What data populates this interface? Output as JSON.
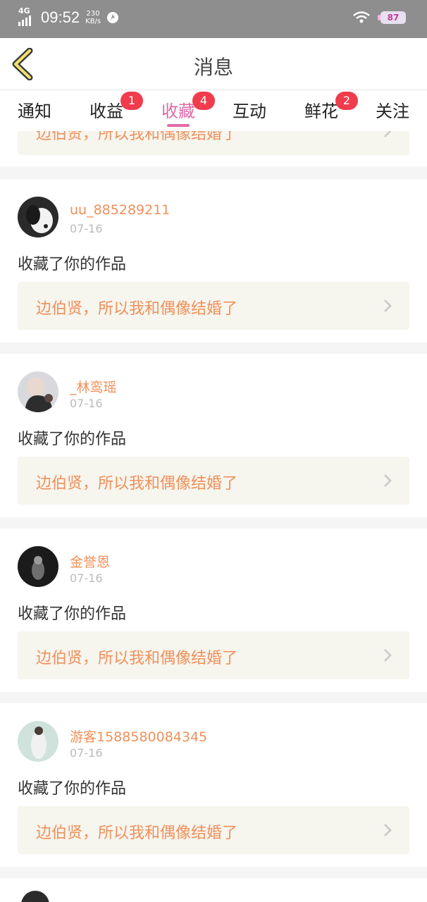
{
  "status_bar": {
    "network": "4G",
    "time": "09:52",
    "speed_value": "230",
    "speed_unit": "KB/s",
    "battery": "87"
  },
  "header": {
    "title": "消息"
  },
  "tabs": [
    {
      "label": "通知",
      "badge": ""
    },
    {
      "label": "收益",
      "badge": "1"
    },
    {
      "label": "收藏",
      "badge": "4",
      "active": true
    },
    {
      "label": "互动",
      "badge": ""
    },
    {
      "label": "鲜花",
      "badge": "2"
    },
    {
      "label": "关注",
      "badge": ""
    }
  ],
  "partial_top_work_title": "边伯贤，所以我和偶像结婚了",
  "items": [
    {
      "username": "uu_885289211",
      "date": "07-16",
      "action": "收藏了你的作品",
      "work_title": "边伯贤，所以我和偶像结婚了"
    },
    {
      "username": "_林鸾瑶",
      "date": "07-16",
      "action": "收藏了你的作品",
      "work_title": "边伯贤，所以我和偶像结婚了"
    },
    {
      "username": "金誉恩",
      "date": "07-16",
      "action": "收藏了你的作品",
      "work_title": "边伯贤，所以我和偶像结婚了"
    },
    {
      "username": "游客1588580084345",
      "date": "07-16",
      "action": "收藏了你的作品",
      "work_title": "边伯贤，所以我和偶像结婚了"
    }
  ],
  "colors": {
    "accent": "#e06aa6",
    "badge": "#f03c4c",
    "username": "#f0905a",
    "work_bg": "#f6f5ee"
  }
}
